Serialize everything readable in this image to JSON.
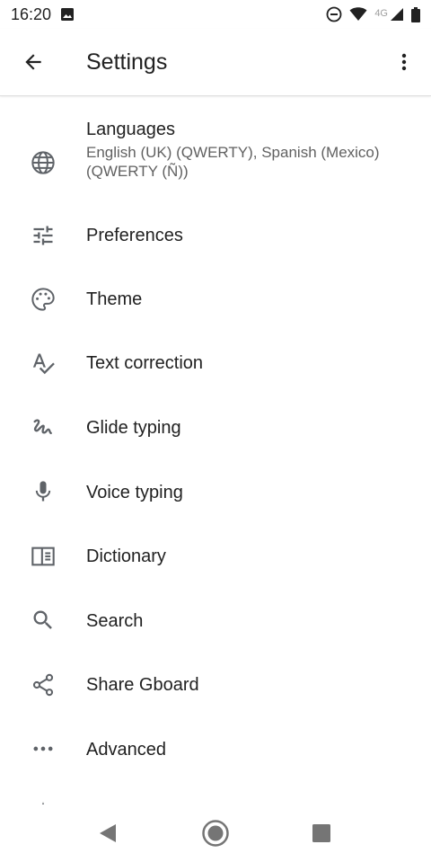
{
  "status_bar": {
    "time": "16:20",
    "network_label": "4G",
    "icons": [
      "image-icon",
      "dnd-icon",
      "wifi-icon",
      "signal-icon",
      "battery-icon"
    ]
  },
  "app_bar": {
    "title": "Settings",
    "back_icon": "arrow-back-icon",
    "menu_icon": "more-vert-icon"
  },
  "settings": {
    "items": [
      {
        "icon": "globe-icon",
        "title": "Languages",
        "subtitle": "English (UK) (QWERTY), Spanish (Mexico) (QWERTY (Ñ))"
      },
      {
        "icon": "tune-icon",
        "title": "Preferences"
      },
      {
        "icon": "palette-icon",
        "title": "Theme"
      },
      {
        "icon": "spellcheck-icon",
        "title": "Text correction"
      },
      {
        "icon": "gesture-icon",
        "title": "Glide typing"
      },
      {
        "icon": "mic-icon",
        "title": "Voice typing"
      },
      {
        "icon": "book-icon",
        "title": "Dictionary"
      },
      {
        "icon": "search-icon",
        "title": "Search"
      },
      {
        "icon": "share-icon",
        "title": "Share Gboard"
      },
      {
        "icon": "more-horiz-icon",
        "title": "Advanced"
      }
    ]
  },
  "colors": {
    "text_primary": "#212121",
    "text_secondary": "#616161",
    "icon": "#5f6368",
    "divider": "#e0e0e0"
  },
  "nav_bar": {
    "icons": [
      "back-triangle-icon",
      "home-circle-icon",
      "recents-square-icon"
    ]
  }
}
